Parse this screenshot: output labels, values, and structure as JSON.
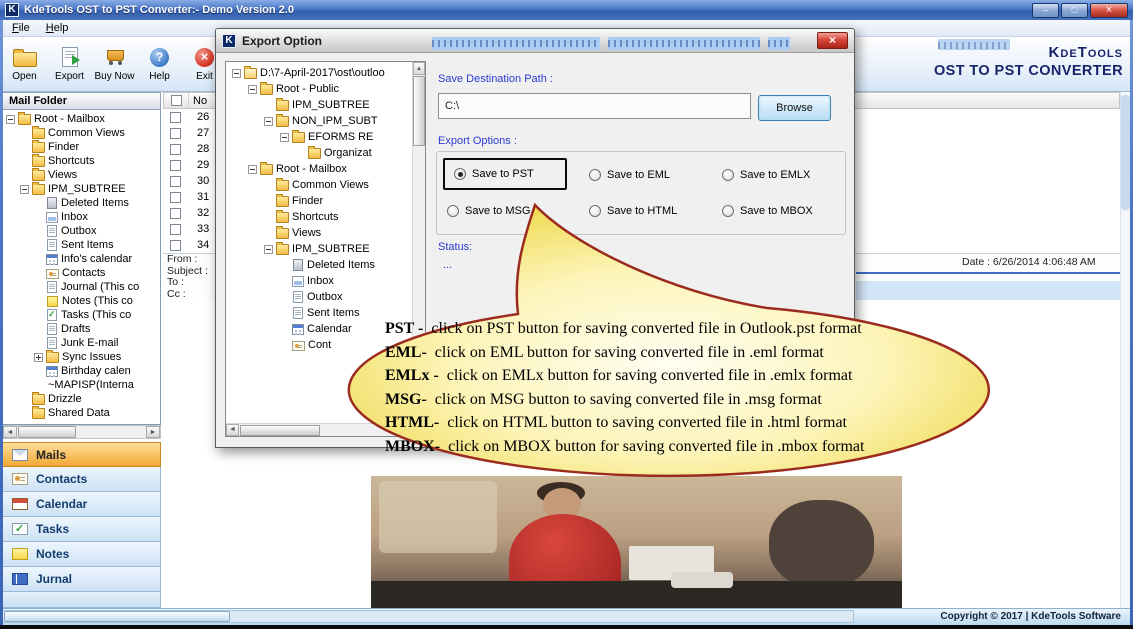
{
  "titlebar": {
    "title": "KdeTools OST to PST Converter:- Demo Version 2.0"
  },
  "menu": {
    "items": [
      {
        "label": "File"
      },
      {
        "label": "Help"
      }
    ]
  },
  "toolbar": {
    "buttons": [
      {
        "label": "Open"
      },
      {
        "label": "Export"
      },
      {
        "label": "Buy Now"
      },
      {
        "label": "Help"
      },
      {
        "label": "Exit"
      }
    ]
  },
  "brand": {
    "logo_letter": "K",
    "name": "KdeTools",
    "product": "OST TO PST CONVERTER"
  },
  "mail_folder": {
    "header": "Mail Folder",
    "tree": [
      {
        "label": "Root - Mailbox"
      },
      {
        "label": "Common Views"
      },
      {
        "label": "Finder"
      },
      {
        "label": "Shortcuts"
      },
      {
        "label": "Views"
      },
      {
        "label": "IPM_SUBTREE"
      },
      {
        "label": "Deleted Items"
      },
      {
        "label": "Inbox"
      },
      {
        "label": "Outbox"
      },
      {
        "label": "Sent Items"
      },
      {
        "label": "Info's calendar"
      },
      {
        "label": "Contacts"
      },
      {
        "label": "Journal (This co"
      },
      {
        "label": "Notes (This co"
      },
      {
        "label": "Tasks (This co"
      },
      {
        "label": "Drafts"
      },
      {
        "label": "Junk E-mail"
      },
      {
        "label": "Sync Issues"
      },
      {
        "label": "Birthday calen"
      },
      {
        "label": "~MAPISP(Interna"
      },
      {
        "label": "Drizzle"
      },
      {
        "label": "Shared Data"
      }
    ],
    "nav": [
      {
        "label": "Mails"
      },
      {
        "label": "Contacts"
      },
      {
        "label": "Calendar"
      },
      {
        "label": "Tasks"
      },
      {
        "label": "Notes"
      },
      {
        "label": "Jurnal"
      }
    ]
  },
  "message_list": {
    "no_header": "No",
    "rows": [
      {
        "no": "26"
      },
      {
        "no": "27"
      },
      {
        "no": "28"
      },
      {
        "no": "29"
      },
      {
        "no": "30"
      },
      {
        "no": "31"
      },
      {
        "no": "32"
      },
      {
        "no": "33"
      },
      {
        "no": "34"
      }
    ]
  },
  "reading_pane": {
    "from_label": "From :",
    "subject_label": "Subject :",
    "to_label": "To :",
    "cc_label": "Cc :",
    "date": "Date :  6/26/2014 4:06:48 AM"
  },
  "export_dialog": {
    "title": "Export Option",
    "tree": [
      {
        "label": "D:\\7-April-2017\\ost\\outloo"
      },
      {
        "label": "Root - Public"
      },
      {
        "label": "IPM_SUBTREE"
      },
      {
        "label": "NON_IPM_SUBT"
      },
      {
        "label": "EFORMS RE"
      },
      {
        "label": "Organizat"
      },
      {
        "label": "Root - Mailbox"
      },
      {
        "label": "Common Views"
      },
      {
        "label": "Finder"
      },
      {
        "label": "Shortcuts"
      },
      {
        "label": "Views"
      },
      {
        "label": "IPM_SUBTREE"
      },
      {
        "label": "Deleted Items"
      },
      {
        "label": "Inbox"
      },
      {
        "label": "Outbox"
      },
      {
        "label": "Sent Items"
      },
      {
        "label": "Calendar"
      },
      {
        "label": "Cont"
      }
    ],
    "save_path_label": "Save Destination Path :",
    "path_value": "C:\\",
    "browse_label": "Browse",
    "export_options_label": "Export Options :",
    "options": [
      {
        "label": "Save to PST",
        "selected": true
      },
      {
        "label": "Save to EML",
        "selected": false
      },
      {
        "label": "Save to EMLX",
        "selected": false
      },
      {
        "label": "Save to MSG",
        "selected": false
      },
      {
        "label": "Save to HTML",
        "selected": false
      },
      {
        "label": "Save to MBOX",
        "selected": false
      }
    ],
    "status_label": "Status:",
    "status_value": "..."
  },
  "callout": {
    "lines": [
      {
        "label": "PST -",
        "text": "click on PST button for saving converted file in Outlook.pst format"
      },
      {
        "label": "EML-",
        "text": "click on EML button for saving converted file in .eml format"
      },
      {
        "label": "EMLx -",
        "text": "click on EMLx button for saving converted file in .emlx format"
      },
      {
        "label": "MSG-",
        "text": "click on MSG button to saving converted file in .msg format"
      },
      {
        "label": "HTML-",
        "text": "click on HTML button to saving converted file in .html format"
      },
      {
        "label": "MBOX-",
        "text": "click on MBOX button for saving converted file in .mbox format"
      }
    ]
  },
  "footer": {
    "copyright": "Copyright © 2017 | KdeTools Software"
  }
}
